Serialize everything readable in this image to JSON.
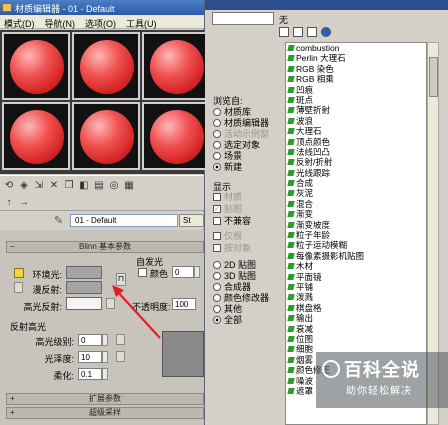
{
  "material_editor": {
    "title": "材质编辑器 - 01 - Default",
    "menu": [
      "模式(D)",
      "导航(N)",
      "选项(O)",
      "工具(U)"
    ],
    "slot_count": 6,
    "material_name": "01 - Default",
    "material_type_button": "St",
    "shader_rollout": "Blinn 基本参数",
    "self_illum_label": "自发光",
    "color_checkbox_label": "颜色",
    "self_illum_value": "0",
    "ambient_label": "环境光:",
    "diffuse_label": "漫反射:",
    "specular_label": "高光反射:",
    "lock_icon": "lock-icon",
    "opacity_label": "不透明度:",
    "opacity_value": "100",
    "specular_highlights_group": "反射高光",
    "spec_level_label": "高光级别:",
    "spec_level_value": "0",
    "glossiness_label": "光泽度:",
    "glossiness_value": "10",
    "soften_label": "柔化:",
    "soften_value": "0.1",
    "extended_rollout": "扩展参数",
    "supersampling_rollout": "超级采样",
    "accent_arrow_color": "#e02020"
  },
  "map_browser": {
    "header": "无",
    "browse_from_title": "浏览自:",
    "browse_from": [
      {
        "label": "材质库",
        "selected": false,
        "disabled": false
      },
      {
        "label": "材质编辑器",
        "selected": false,
        "disabled": false
      },
      {
        "label": "活动示例窗",
        "selected": false,
        "disabled": true
      },
      {
        "label": "选定对象",
        "selected": false,
        "disabled": false
      },
      {
        "label": "场景",
        "selected": false,
        "disabled": false
      },
      {
        "label": "新建",
        "selected": true,
        "disabled": false
      }
    ],
    "show_title": "显示",
    "show": [
      {
        "label": "材质",
        "checked": false,
        "disabled": true
      },
      {
        "label": "贴图",
        "checked": true,
        "disabled": true
      },
      {
        "label": "不兼容",
        "checked": false,
        "disabled": false
      }
    ],
    "extra_checks": [
      {
        "label": "仅根",
        "disabled": true
      },
      {
        "label": "按对象",
        "disabled": true
      }
    ],
    "categories": [
      {
        "label": "2D 贴图",
        "selected": false
      },
      {
        "label": "3D 贴图",
        "selected": false
      },
      {
        "label": "合成器",
        "selected": false
      },
      {
        "label": "颜色修改器",
        "selected": false
      },
      {
        "label": "其他",
        "selected": false
      },
      {
        "label": "全部",
        "selected": true
      }
    ],
    "maps": [
      "combustion",
      "Perlin 大理石",
      "RGB 染色",
      "RGB 相乘",
      "凹痕",
      "斑点",
      "薄壁折射",
      "波浪",
      "大理石",
      "顶点颜色",
      "法线凹凸",
      "反射/折射",
      "光线跟踪",
      "合成",
      "灰泥",
      "混合",
      "渐变",
      "渐变坡度",
      "粒子年龄",
      "粒子运动模糊",
      "每像素摄影机贴图",
      "木材",
      "平面镜",
      "平铺",
      "泼溅",
      "棋盘格",
      "输出",
      "衰减",
      "位图",
      "细胞",
      "烟雾",
      "颜色修正",
      "噪波",
      "遮罩"
    ]
  },
  "watermark": {
    "title": "百科全说",
    "subtitle": "助你轻松解决"
  }
}
